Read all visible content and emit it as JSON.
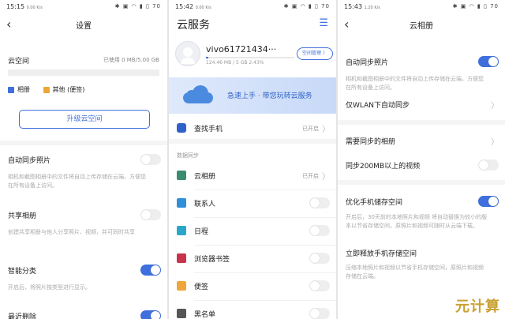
{
  "panel1": {
    "status_time": "15:15",
    "status_sub": "0.00 K/s",
    "status_icons": "✱ ▣ ◠ ▮ ▯ 70",
    "title": "设置",
    "cloud_label": "云空间",
    "cloud_usage": "已使用 0 MB/5.00 GB",
    "legend_album": "相册",
    "legend_other": "其他 (便签)",
    "upgrade_button": "升级云空间",
    "auto_sync_label": "自动同步照片",
    "auto_sync_hint": "相机和截图相册中的文件将自动上传存储在云端，方便您在所有设备上访问。",
    "shared_album_label": "共享相册",
    "shared_album_hint": "创建共享相册与他人分享照片、视频，并可同时共享",
    "smart_class_label": "智能分类",
    "smart_class_hint": "开启后，将照片按类型进行显示。",
    "recent_delete_label": "最近删除",
    "colors": {
      "album": "#3f6fdc",
      "other": "#f0a53a"
    }
  },
  "panel2": {
    "status_time": "15:42",
    "status_sub": "0.00 K/s",
    "status_icons": "✱ ▣ ◠ ▮ ▯ 70",
    "title": "云服务",
    "menu_icon": "menu-lines-icon",
    "username": "vivo61721434···",
    "storage_text": "124.46 MB / 5 GB 2.43%",
    "space_manage_button": "空间管理 〉",
    "banner_text": "急速上手 · 带您玩转云服务",
    "find_phone_label": "查找手机",
    "find_phone_status": "已开启",
    "data_sync_header": "数据同步",
    "items": [
      {
        "label": "云相册",
        "status": "已开启",
        "icon_color": "#3b8c6e"
      },
      {
        "label": "联系人",
        "status": "",
        "icon_color": "#2f8fd8"
      },
      {
        "label": "日程",
        "status": "",
        "icon_color": "#2aa6c8"
      },
      {
        "label": "浏览器书签",
        "status": "",
        "icon_color": "#c8324a"
      },
      {
        "label": "便签",
        "status": "",
        "icon_color": "#f0a53a"
      },
      {
        "label": "黑名单",
        "status": "",
        "icon_color": "#555555"
      }
    ]
  },
  "panel3": {
    "status_time": "15:43",
    "status_sub": "1.20 K/s",
    "status_icons": "✱ ▣ ◠ ▮ ▯ 70",
    "title": "云相册",
    "auto_sync_label": "自动同步照片",
    "auto_sync_hint": "相机和截图相册中的文件将自动上传存储在云端，方便您在所有设备上访问。",
    "wlan_label": "仅WLAN下自动同步",
    "albums_label": "需要同步的相册",
    "video_label": "同步200MB以上的视频",
    "optimize_label": "优化手机储存空间",
    "optimize_hint": "开启后，30天前的本地照片和视频 将自动替换为较小的版本以节省存储空间，原照片和视频可随时从云端下载。",
    "free_label": "立即释放手机存储空间",
    "free_hint": "压缩本地照片和视频以节省手机存储空间，原照片和视频存储在云端。"
  },
  "watermark": "元计算"
}
